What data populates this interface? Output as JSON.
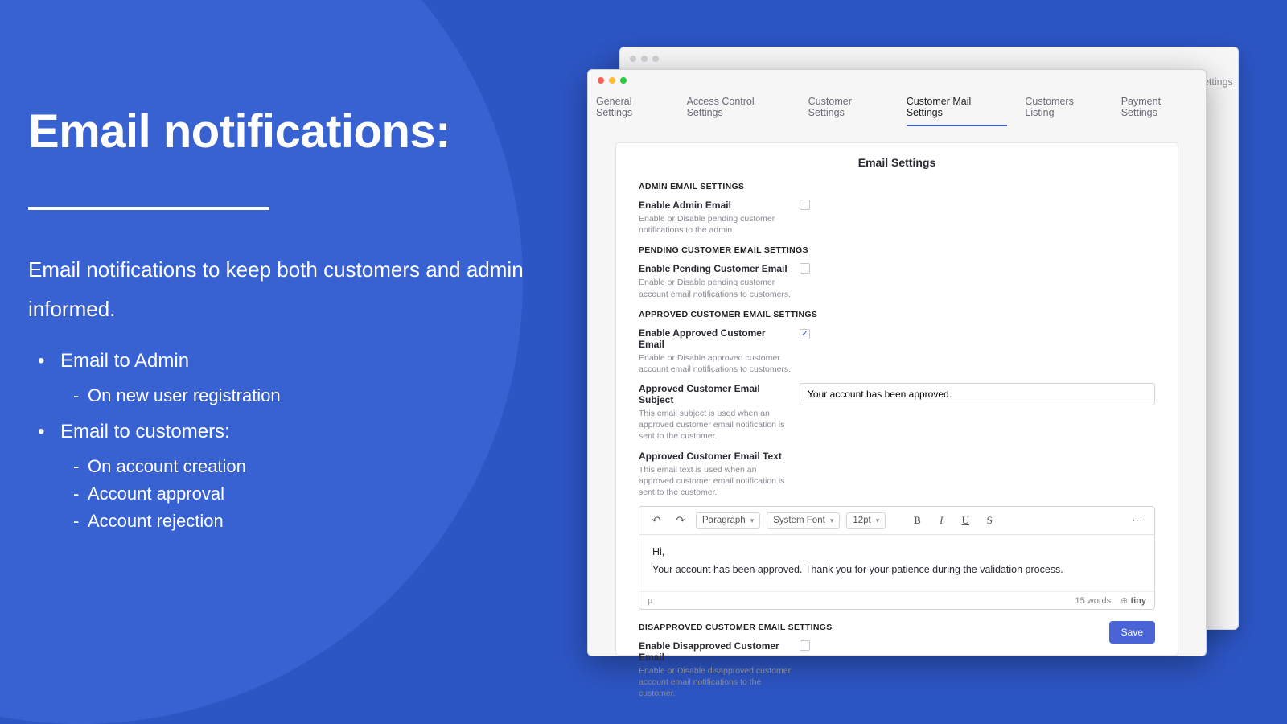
{
  "left": {
    "title": "Email notifications:",
    "subtitle": "Email notifications to keep both customers and admin informed.",
    "bullets": {
      "b1": "Email to Admin",
      "b1s1": "On new user registration",
      "b2": "Email to customers:",
      "b2s1": "On account creation",
      "b2s2": "Account approval",
      "b2s3": "Account rejection"
    }
  },
  "tabs": {
    "t1": "General Settings",
    "t2": "Access Control Settings",
    "t3": "Customer Settings",
    "t4": "Customer Mail Settings",
    "t5": "Customers Listing",
    "t6": "Payment Settings"
  },
  "panel": {
    "title": "Email Settings",
    "sections": {
      "s1": "ADMIN EMAIL SETTINGS",
      "s2": "PENDING CUSTOMER EMAIL SETTINGS",
      "s3": "APPROVED CUSTOMER EMAIL SETTINGS",
      "s4": "DISAPPROVED CUSTOMER EMAIL SETTINGS"
    },
    "settings": {
      "adminEnable": {
        "label": "Enable Admin Email",
        "desc": "Enable or Disable pending customer notifications to the admin.",
        "checked": false
      },
      "pendingEnable": {
        "label": "Enable Pending Customer Email",
        "desc": "Enable or Disable pending customer account email notifications to customers.",
        "checked": false
      },
      "approvedEnable": {
        "label": "Enable Approved Customer Email",
        "desc": "Enable or Disable approved customer account email notifications to customers.",
        "checked": true
      },
      "approvedSubject": {
        "label": "Approved Customer Email Subject",
        "desc": "This email subject is used when an approved customer email notification is sent to the customer.",
        "value": "Your account has been approved."
      },
      "approvedText": {
        "label": "Approved Customer Email Text",
        "desc": "This email text is used when an approved customer email notification is sent to the customer."
      },
      "disapprovedEnable": {
        "label": "Enable Disapproved Customer Email",
        "desc": "Enable or Disable disapproved customer account email notifications to the customer.",
        "checked": false
      }
    },
    "editor": {
      "paragraph": "Paragraph",
      "font": "System Font",
      "size": "12pt",
      "line1": "Hi,",
      "line2": "Your account has been approved. Thank you for your patience during the validation process.",
      "path": "p",
      "words": "15 words",
      "powered": "tiny"
    },
    "saveBtn": "Save"
  }
}
